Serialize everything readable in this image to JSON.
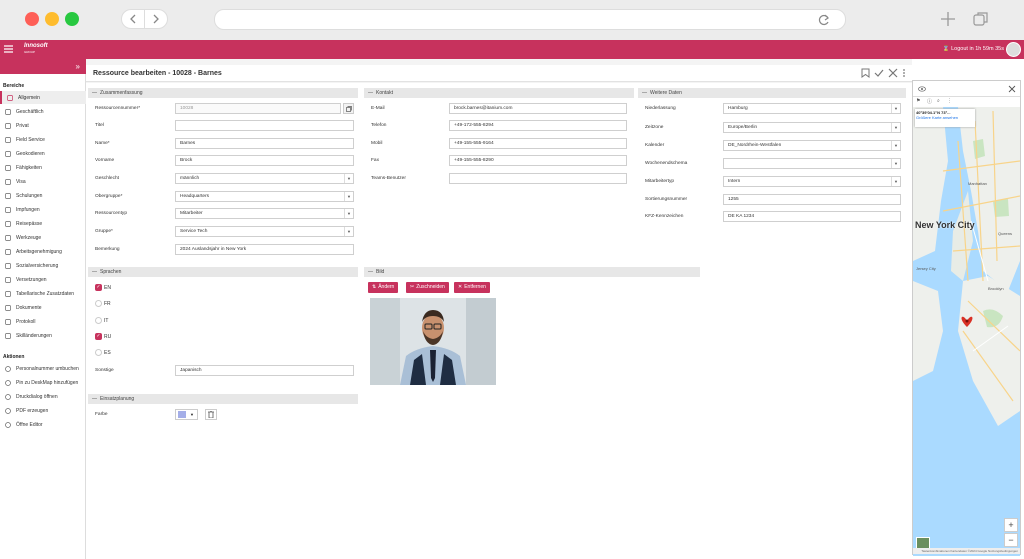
{
  "header": {
    "logout_text": "Logout in 1h 59m 35s",
    "logo_text": "Innosoft",
    "logo_sub": "GROUP"
  },
  "page": {
    "title": "Ressource bearbeiten - 10028 - Barnes"
  },
  "sidebar": {
    "section_areas": "Bereiche",
    "items": [
      {
        "label": "Allgemein",
        "icon": "person-icon"
      },
      {
        "label": "Geschäftlich",
        "icon": "briefcase-icon"
      },
      {
        "label": "Privat",
        "icon": "home-icon"
      },
      {
        "label": "Field Service",
        "icon": "tools-icon"
      },
      {
        "label": "Geokodieren",
        "icon": "globe-icon"
      },
      {
        "label": "Fähigkeiten",
        "icon": "list-icon"
      },
      {
        "label": "Visa",
        "icon": "plane-icon"
      },
      {
        "label": "Schulungen",
        "icon": "cap-icon"
      },
      {
        "label": "Impfungen",
        "icon": "syringe-icon"
      },
      {
        "label": "Reisepässe",
        "icon": "passport-icon"
      },
      {
        "label": "Werkzeuge",
        "icon": "wrench-icon"
      },
      {
        "label": "Arbeitsgenehmigung",
        "icon": "doc-icon"
      },
      {
        "label": "Sozialversicherung",
        "icon": "shield-icon"
      },
      {
        "label": "Versetzungen",
        "icon": "transfer-icon"
      },
      {
        "label": "Tabellarische Zusatzdaten",
        "icon": "table-icon"
      },
      {
        "label": "Dokumente",
        "icon": "folder-icon"
      },
      {
        "label": "Protokoll",
        "icon": "log-icon"
      },
      {
        "label": "Skilländerungen",
        "icon": "edit-icon"
      }
    ],
    "section_actions": "Aktionen",
    "actions": [
      {
        "label": "Personalnummer umbuchen",
        "icon": "swap-icon"
      },
      {
        "label": "Pin zu DeskMap hinzufügen",
        "icon": "pin-icon"
      },
      {
        "label": "Druckdialog öffnen",
        "icon": "printer-icon"
      },
      {
        "label": "PDF erzeugen",
        "icon": "pdf-icon"
      },
      {
        "label": "Öffne Editor",
        "icon": "editor-icon"
      }
    ]
  },
  "summary": {
    "header": "Zusammenfassung",
    "fields": [
      {
        "label": "Ressourcennummer*",
        "value": "10028",
        "type": "disabled"
      },
      {
        "label": "Titel",
        "value": "",
        "type": "text"
      },
      {
        "label": "Name*",
        "value": "Barnes",
        "type": "text"
      },
      {
        "label": "Vorname",
        "value": "Brock",
        "type": "text"
      },
      {
        "label": "Geschlecht",
        "value": "männlich",
        "type": "select"
      },
      {
        "label": "Obergruppe*",
        "value": "Headquarters",
        "type": "select"
      },
      {
        "label": "Ressourcentyp",
        "value": "Mitarbeiter",
        "type": "select"
      },
      {
        "label": "Gruppe*",
        "value": "Service Tech",
        "type": "select"
      },
      {
        "label": "Bemerkung",
        "value": "2024 Auslandsjahr in New York",
        "type": "text"
      }
    ]
  },
  "contact": {
    "header": "Kontakt",
    "fields": [
      {
        "label": "E-Mail",
        "value": "brock.barnes@itanium.com"
      },
      {
        "label": "Telefon",
        "value": "+49-172-555-8294"
      },
      {
        "label": "Mobil",
        "value": "+49-155-555-9164"
      },
      {
        "label": "Fax",
        "value": "+49-155-555-8290"
      },
      {
        "label": "Teams-Benutzer",
        "value": ""
      }
    ]
  },
  "more": {
    "header": "Weitere Daten",
    "fields": [
      {
        "label": "Niederlassung",
        "value": "Hamburg",
        "type": "select"
      },
      {
        "label": "Zeitzone",
        "value": "Europe/Berlin",
        "type": "select"
      },
      {
        "label": "Kalender",
        "value": "DE_Nordrhein-Westfalen",
        "type": "select"
      },
      {
        "label": "Wochenendschema",
        "value": "",
        "type": "select"
      },
      {
        "label": "Mitarbeitertyp",
        "value": "Intern",
        "type": "select"
      },
      {
        "label": "Sortierungsnummer",
        "value": "1255",
        "type": "text"
      },
      {
        "label": "KFZ-Kennzeichen",
        "value": "DE KA 1234",
        "type": "text"
      }
    ]
  },
  "languages": {
    "header": "Sprachen",
    "items": [
      {
        "code": "EN",
        "checked": true
      },
      {
        "code": "FR",
        "checked": false
      },
      {
        "code": "IT",
        "checked": false
      },
      {
        "code": "RU",
        "checked": true
      },
      {
        "code": "ES",
        "checked": false
      }
    ],
    "other_label": "Sonstige",
    "other_value": "Japanisch"
  },
  "image": {
    "header": "Bild",
    "buttons": [
      {
        "label": "Ändern",
        "icon": "change-icon"
      },
      {
        "label": "Zuschneiden",
        "icon": "crop-icon"
      },
      {
        "label": "Entfernen",
        "icon": "remove-icon"
      }
    ]
  },
  "scheduling": {
    "header": "Einsatzplanung",
    "color_label": "Farbe",
    "color": "#a4aee8"
  },
  "map": {
    "coords": "40°39'04.1\"N 73°...",
    "link": "Größere Karte ansehen",
    "city": "New York City",
    "labels": [
      "Brooklyn",
      "Manhattan",
      "Queens",
      "Jersey City"
    ],
    "attribution": "Tastenkombinationen  Kartendaten ©2024 Google  Nutzungsbedingungen"
  }
}
